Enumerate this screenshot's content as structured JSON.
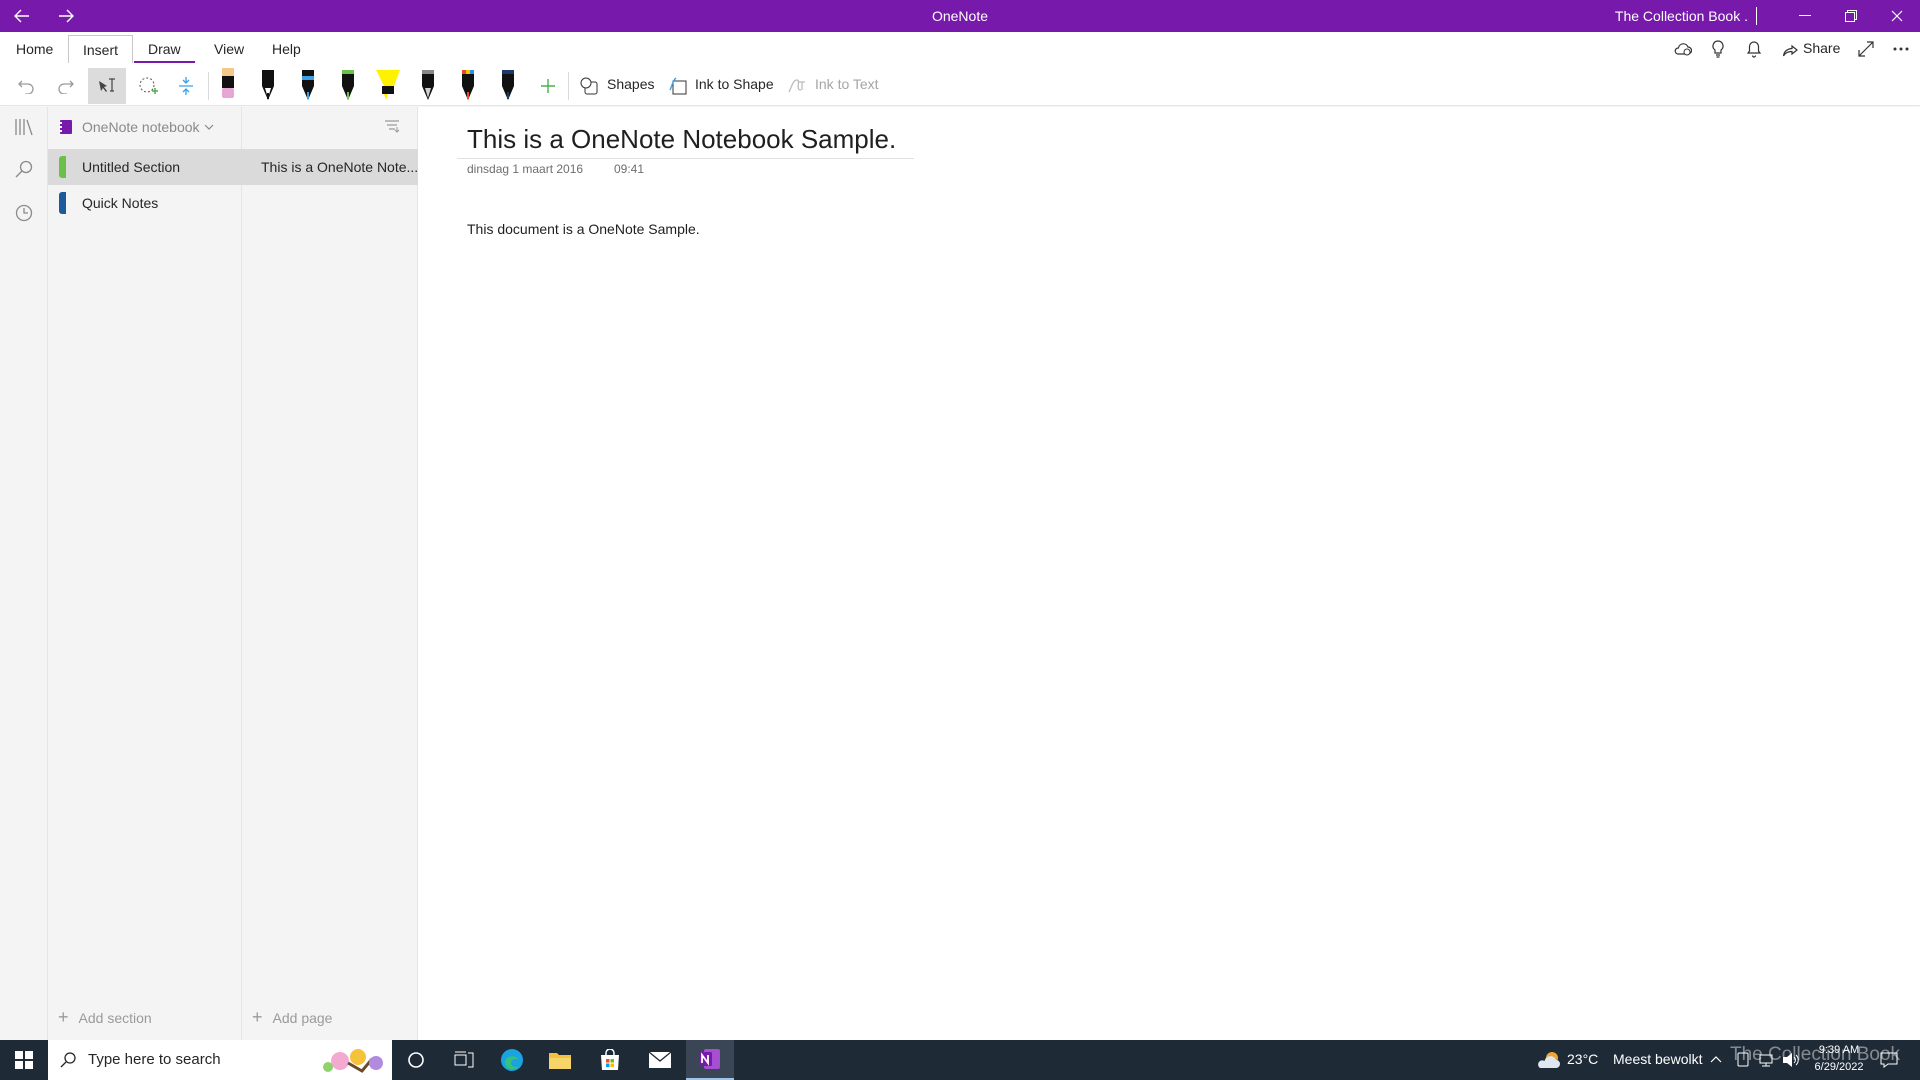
{
  "titlebar": {
    "app_title": "OneNote",
    "user": "The Collection Book ."
  },
  "ribbon": {
    "tabs": [
      "Home",
      "Insert",
      "Draw",
      "View",
      "Help"
    ],
    "share_label": "Share",
    "active_tab": "Draw"
  },
  "toolbar": {
    "shapes_label": "Shapes",
    "ink_to_shape_label": "Ink to Shape",
    "ink_to_text_label": "Ink to Text",
    "pens": [
      {
        "name": "pink-eraser-pen",
        "color": "#e6a6d6"
      },
      {
        "name": "black-pen",
        "color": "#111111"
      },
      {
        "name": "blue-pen",
        "color": "#3aa0e8"
      },
      {
        "name": "green-pen",
        "color": "#6cc04a"
      },
      {
        "name": "yellow-highlighter",
        "color": "#fff200"
      },
      {
        "name": "galaxy-pen",
        "color": "#444444"
      },
      {
        "name": "rainbow-pen",
        "color": "#e84a2c"
      },
      {
        "name": "dark-blue-pen",
        "color": "#1b3a6b"
      }
    ]
  },
  "notebook": {
    "name": "OneNote notebook",
    "sections": [
      {
        "label": "Untitled Section",
        "color": "#6cc04a",
        "selected": true
      },
      {
        "label": "Quick Notes",
        "color": "#1c5a9c",
        "selected": false
      }
    ],
    "pages": [
      {
        "label": "This is a OneNote Note..."
      }
    ],
    "add_section": "Add section",
    "add_page": "Add page"
  },
  "page": {
    "title": "This is a OneNote Notebook Sample.",
    "date": "dinsdag 1 maart 2016",
    "time": "09:41",
    "body": "This document is a OneNote Sample."
  },
  "taskbar": {
    "search_placeholder": "Type here to search",
    "weather_temp": "23°C",
    "weather_text": "Meest bewolkt",
    "time": "9:39 AM",
    "date": "6/29/2022",
    "watermark": "The Collection Book"
  },
  "colors": {
    "accent": "#7719aa",
    "taskbar": "#1f2a37"
  }
}
